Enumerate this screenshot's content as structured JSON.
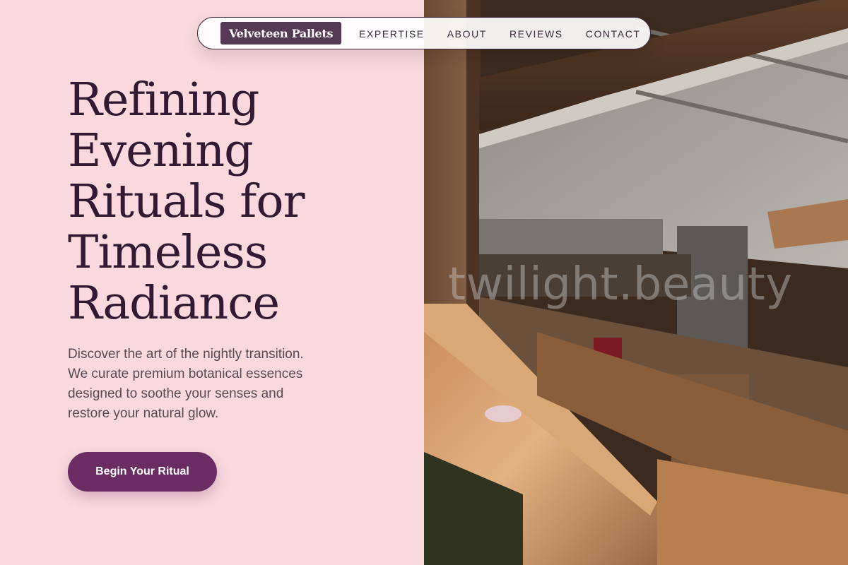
{
  "brand": {
    "name": "Velveteen Pallets"
  },
  "nav": {
    "links": [
      "EXPERTISE",
      "ABOUT",
      "REVIEWS",
      "CONTACT"
    ]
  },
  "hero": {
    "title_lines": [
      "Refining",
      "Evening",
      "Rituals for",
      "Timeless",
      "Radiance"
    ],
    "description_lines": [
      "Discover the art of the nightly transition.",
      "We curate premium botanical essences",
      "designed to soothe your senses and",
      "restore your natural glow."
    ],
    "cta_label": "Begin Your Ritual"
  },
  "image": {
    "subject": "stacked-wooden-pallets",
    "watermark": "twilight.beauty"
  },
  "colors": {
    "background": "#f9d9de",
    "heading": "#331a33",
    "body_text": "#5a4a55",
    "accent": "#6b2c63",
    "brand_bg": "#553a55"
  }
}
